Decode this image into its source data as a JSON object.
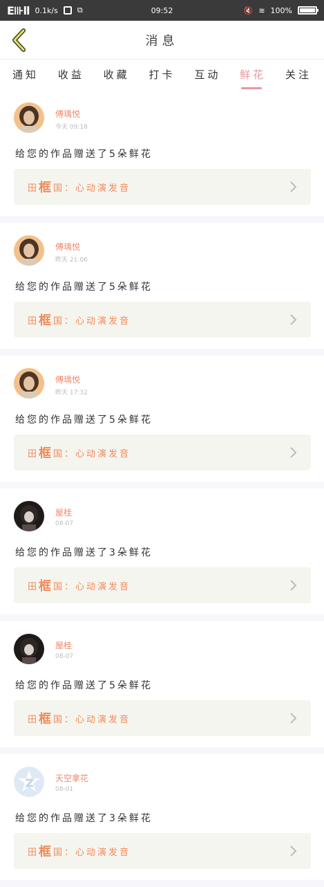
{
  "status": {
    "left_text": "E⊪ll",
    "speed": "0.1k/s",
    "time": "09:52",
    "battery": "100%"
  },
  "header": {
    "title": "消息"
  },
  "tabs": [
    {
      "label": "通知",
      "active": false
    },
    {
      "label": "收益",
      "active": false
    },
    {
      "label": "收藏",
      "active": false
    },
    {
      "label": "打卡",
      "active": false
    },
    {
      "label": "互动",
      "active": false
    },
    {
      "label": "鲜花",
      "active": true
    },
    {
      "label": "关注",
      "active": false
    }
  ],
  "items": [
    {
      "name": "傅瑀悦",
      "time": "今天 09:18",
      "message": "给您的作品赠送了5朵鲜花",
      "work_title_prefix": "田",
      "work_title_big": "框",
      "work_title_rest": "国：心动演发音"
    },
    {
      "name": "傅瑀悦",
      "time": "昨天 21:06",
      "message": "给您的作品赠送了5朵鲜花",
      "work_title_prefix": "田",
      "work_title_big": "框",
      "work_title_rest": "国：心动演发音"
    },
    {
      "name": "傅瑀悦",
      "time": "昨天 17:32",
      "message": "给您的作品赠送了5朵鲜花",
      "work_title_prefix": "田",
      "work_title_big": "框",
      "work_title_rest": "国：心动演发音"
    },
    {
      "name": "屋桂",
      "time": "08-07",
      "message": "给您的作品赠送了3朵鲜花",
      "work_title_prefix": "田",
      "work_title_big": "框",
      "work_title_rest": "国：心动演发音"
    },
    {
      "name": "屋桂",
      "time": "08-07",
      "message": "给您的作品赠送了5朵鲜花",
      "work_title_prefix": "田",
      "work_title_big": "框",
      "work_title_rest": "国：心动演发音"
    },
    {
      "name": "天空拿花",
      "time": "08-01",
      "message": "给您的作品赠送了3朵鲜花",
      "work_title_prefix": "田",
      "work_title_big": "框",
      "work_title_rest": "国：心动演发音"
    }
  ]
}
